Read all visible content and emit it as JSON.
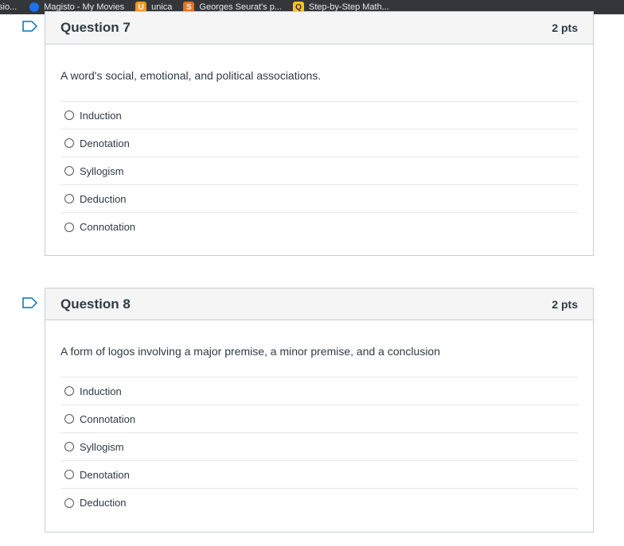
{
  "bookmarks_bar": {
    "items": [
      {
        "label": "sio...",
        "icon": "none"
      },
      {
        "label": "Magisto - My Movies",
        "icon": "magisto-icon"
      },
      {
        "label": "unica",
        "icon": "u-icon"
      },
      {
        "label": "Georges Seurat's p...",
        "icon": "s-icon"
      },
      {
        "label": "Step-by-Step Math...",
        "icon": "q-icon"
      }
    ]
  },
  "questions": [
    {
      "title": "Question 7",
      "points": "2 pts",
      "text": "A word's social, emotional, and political associations.",
      "answers": [
        "Induction",
        "Denotation",
        "Syllogism",
        "Deduction",
        "Connotation"
      ]
    },
    {
      "title": "Question 8",
      "points": "2 pts",
      "text": "A form of logos involving a major premise, a minor premise, and a conclusion",
      "answers": [
        "Induction",
        "Connotation",
        "Syllogism",
        "Denotation",
        "Deduction"
      ]
    }
  ],
  "colors": {
    "header_bg": "#f5f5f5",
    "border": "#c7cdd1",
    "text": "#2d3b45",
    "flag": "#0374b5"
  }
}
